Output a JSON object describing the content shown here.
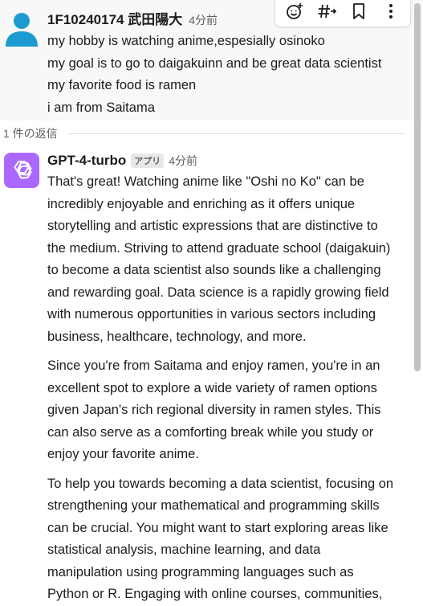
{
  "parent": {
    "author": "1F10240174 武田陽大",
    "time": "4分前",
    "lines": [
      "my hobby is watching anime,espesially osinoko",
      "my goal is to go to daigakuinn and be great data scientist",
      "my favorite food is ramen",
      "i am from Saitama"
    ]
  },
  "toolbar": {
    "icons": [
      "add-reaction-icon",
      "channel-hashtag-icon",
      "bookmark-icon",
      "more-actions-icon"
    ]
  },
  "thread": {
    "reply_count": "1 件の返信"
  },
  "reply": {
    "author": "GPT-4-turbo",
    "badge": "アプリ",
    "time": "4分前",
    "paragraphs": [
      [
        "That's great! Watching anime like \"Oshi no Ko\" can be",
        "incredibly enjoyable and enriching as it offers unique",
        "storytelling and artistic expressions that are distinctive to",
        "the medium. Striving to attend graduate school (daigakuin)",
        "to become a data scientist also sounds like a challenging",
        "and rewarding goal. Data science is a rapidly growing field",
        "with numerous opportunities in various sectors including",
        "business, healthcare, technology, and more."
      ],
      [
        "Since you're from Saitama and enjoy ramen, you're in an",
        "excellent spot to explore a wide variety of ramen options",
        "given Japan's rich regional diversity in ramen styles. This",
        "can also serve as a comforting break while you study or",
        "enjoy your favorite anime."
      ],
      [
        "To help you towards becoming a data scientist, focusing on",
        "strengthening your mathematical and programming skills",
        "can be crucial. You might want to start exploring areas like",
        "statistical analysis, machine learning, and data",
        "manipulation using programming languages such as",
        "Python or R. Engaging with online courses, communities,"
      ]
    ]
  },
  "colors": {
    "user_avatar": "#1d9bd1",
    "gpt_avatar": "#ab68ff",
    "parent_background": "#f8f8f8"
  }
}
